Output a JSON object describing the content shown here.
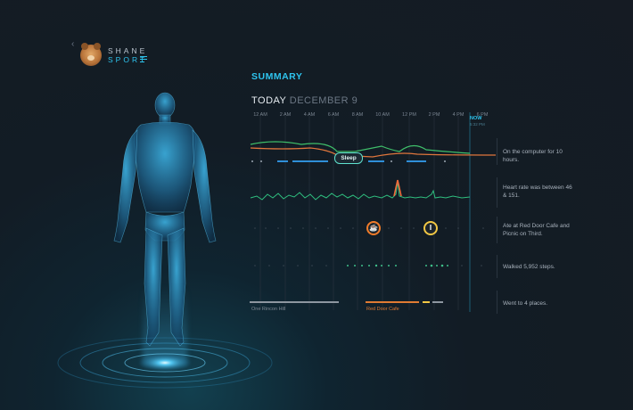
{
  "header": {
    "back_icon": "‹",
    "brand_top": "SHANE",
    "brand_bottom": "SPORT"
  },
  "summary": {
    "title": "SUMMARY",
    "today_label": "TODAY",
    "date": "DECEMBER 9",
    "hours": [
      "12 AM",
      "2 AM",
      "4 AM",
      "6 AM",
      "8 AM",
      "10 AM",
      "12 PM",
      "2 PM",
      "4 PM",
      "6 PM"
    ],
    "now_label": "NOW",
    "now_time": "5:32 PM",
    "sleep_label": "Sleep",
    "places": [
      "One Rincon Hill",
      "Red Door Cafe"
    ]
  },
  "insights": [
    {
      "text": "On the computer for 10 hours."
    },
    {
      "text": "Heart rate was between 46 & 151."
    },
    {
      "text": "Ate at Red Door Cafe and Picnic on Third."
    },
    {
      "text": "Walked 5,952 steps."
    },
    {
      "text": "Went to 4 places."
    }
  ],
  "colors": {
    "accent": "#2ec4ee",
    "heart": "#2fbf7f",
    "peak": "#f26a3a",
    "meal1": "#f07c2a",
    "meal2": "#f2c744"
  },
  "icons": {
    "meal1": "coffee-cup-icon",
    "meal2": "fork-knife-icon"
  }
}
